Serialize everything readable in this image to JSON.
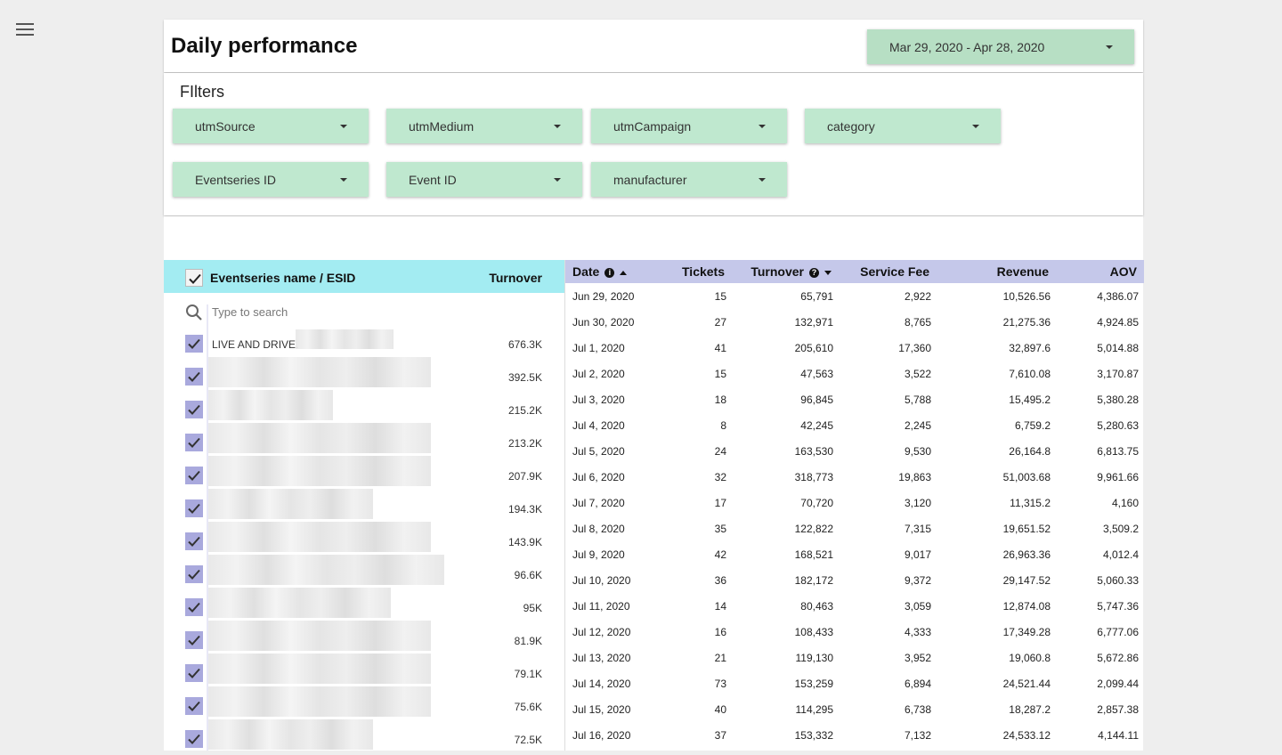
{
  "header": {
    "title": "Daily performance",
    "date_range": "Mar 29, 2020 - Apr 28, 2020"
  },
  "filters": {
    "title": "FIlters",
    "items": [
      "utmSource",
      "utmMedium",
      "utmCampaign",
      "category",
      "Eventseries ID",
      "Event ID",
      "manufacturer"
    ]
  },
  "series_panel": {
    "header_name": "Eventseries name / ESID",
    "header_turnover": "Turnover",
    "search_placeholder": "Type to search",
    "items": [
      {
        "label": "LIVE AND DRIVE.",
        "value": "676.3K"
      },
      {
        "label": "",
        "value": "392.5K"
      },
      {
        "label": "",
        "value": "215.2K"
      },
      {
        "label": "",
        "value": "213.2K"
      },
      {
        "label": "",
        "value": "207.9K"
      },
      {
        "label": "",
        "value": "194.3K"
      },
      {
        "label": "",
        "value": "143.9K"
      },
      {
        "label": "",
        "value": "96.6K"
      },
      {
        "label": "",
        "value": "95K"
      },
      {
        "label": "",
        "value": "81.9K"
      },
      {
        "label": "",
        "value": "79.1K"
      },
      {
        "label": "",
        "value": "75.6K"
      },
      {
        "label": "",
        "value": "72.5K"
      }
    ]
  },
  "table": {
    "columns": [
      "Date",
      "Tickets",
      "Turnover",
      "Service Fee",
      "Revenue",
      "AOV"
    ],
    "rows": [
      [
        "Jun 29, 2020",
        "15",
        "65,791",
        "2,922",
        "10,526.56",
        "4,386.07"
      ],
      [
        "Jun 30, 2020",
        "27",
        "132,971",
        "8,765",
        "21,275.36",
        "4,924.85"
      ],
      [
        "Jul 1, 2020",
        "41",
        "205,610",
        "17,360",
        "32,897.6",
        "5,014.88"
      ],
      [
        "Jul 2, 2020",
        "15",
        "47,563",
        "3,522",
        "7,610.08",
        "3,170.87"
      ],
      [
        "Jul 3, 2020",
        "18",
        "96,845",
        "5,788",
        "15,495.2",
        "5,380.28"
      ],
      [
        "Jul 4, 2020",
        "8",
        "42,245",
        "2,245",
        "6,759.2",
        "5,280.63"
      ],
      [
        "Jul 5, 2020",
        "24",
        "163,530",
        "9,530",
        "26,164.8",
        "6,813.75"
      ],
      [
        "Jul 6, 2020",
        "32",
        "318,773",
        "19,863",
        "51,003.68",
        "9,961.66"
      ],
      [
        "Jul 7, 2020",
        "17",
        "70,720",
        "3,120",
        "11,315.2",
        "4,160"
      ],
      [
        "Jul 8, 2020",
        "35",
        "122,822",
        "7,315",
        "19,651.52",
        "3,509.2"
      ],
      [
        "Jul 9, 2020",
        "42",
        "168,521",
        "9,017",
        "26,963.36",
        "4,012.4"
      ],
      [
        "Jul 10, 2020",
        "36",
        "182,172",
        "9,372",
        "29,147.52",
        "5,060.33"
      ],
      [
        "Jul 11, 2020",
        "14",
        "80,463",
        "3,059",
        "12,874.08",
        "5,747.36"
      ],
      [
        "Jul 12, 2020",
        "16",
        "108,433",
        "4,333",
        "17,349.28",
        "6,777.06"
      ],
      [
        "Jul 13, 2020",
        "21",
        "119,130",
        "3,952",
        "19,060.8",
        "5,672.86"
      ],
      [
        "Jul 14, 2020",
        "73",
        "153,259",
        "6,894",
        "24,521.44",
        "2,099.44"
      ],
      [
        "Jul 15, 2020",
        "40",
        "114,295",
        "6,738",
        "18,287.2",
        "2,857.38"
      ],
      [
        "Jul 16, 2020",
        "37",
        "153,332",
        "7,132",
        "24,533.12",
        "4,144.11"
      ]
    ]
  }
}
